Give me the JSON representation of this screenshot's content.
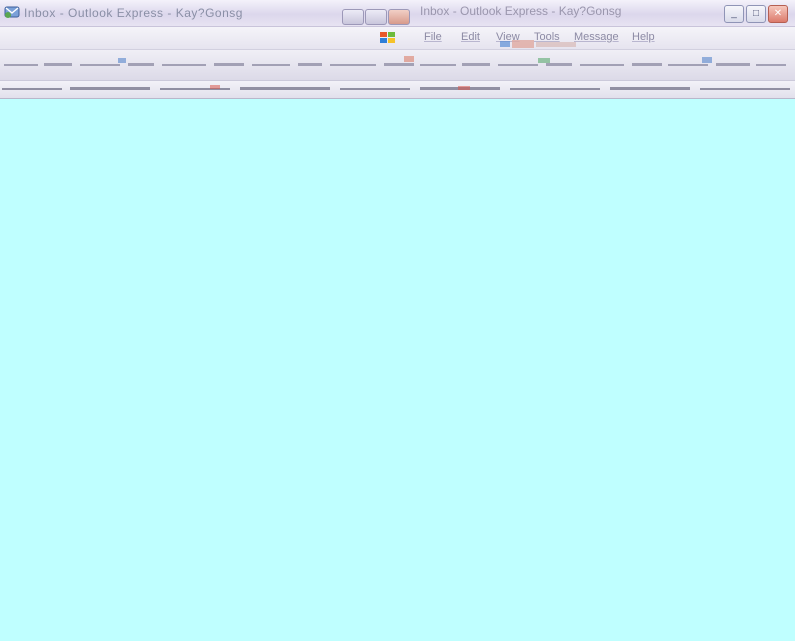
{
  "window": {
    "title": "Inbox - Outlook Express - Kay?Gonsg",
    "title_echo": "Inbox - Outlook Express - Kay?Gonsg",
    "controls": {
      "minimize": "_",
      "maximize": "□",
      "close": "✕"
    }
  },
  "menu": {
    "items": [
      {
        "label": "File"
      },
      {
        "label": "Edit"
      },
      {
        "label": "View"
      },
      {
        "label": "Tools"
      },
      {
        "label": "Message"
      },
      {
        "label": "Help"
      }
    ]
  },
  "colors": {
    "content_background": "#bfffff",
    "chrome": "#e4e2ee",
    "close_button": "#dc7b6c"
  },
  "icons": [
    "outlook-express-icon",
    "windows-flag-icon",
    "minimize-icon",
    "maximize-icon",
    "close-icon"
  ]
}
